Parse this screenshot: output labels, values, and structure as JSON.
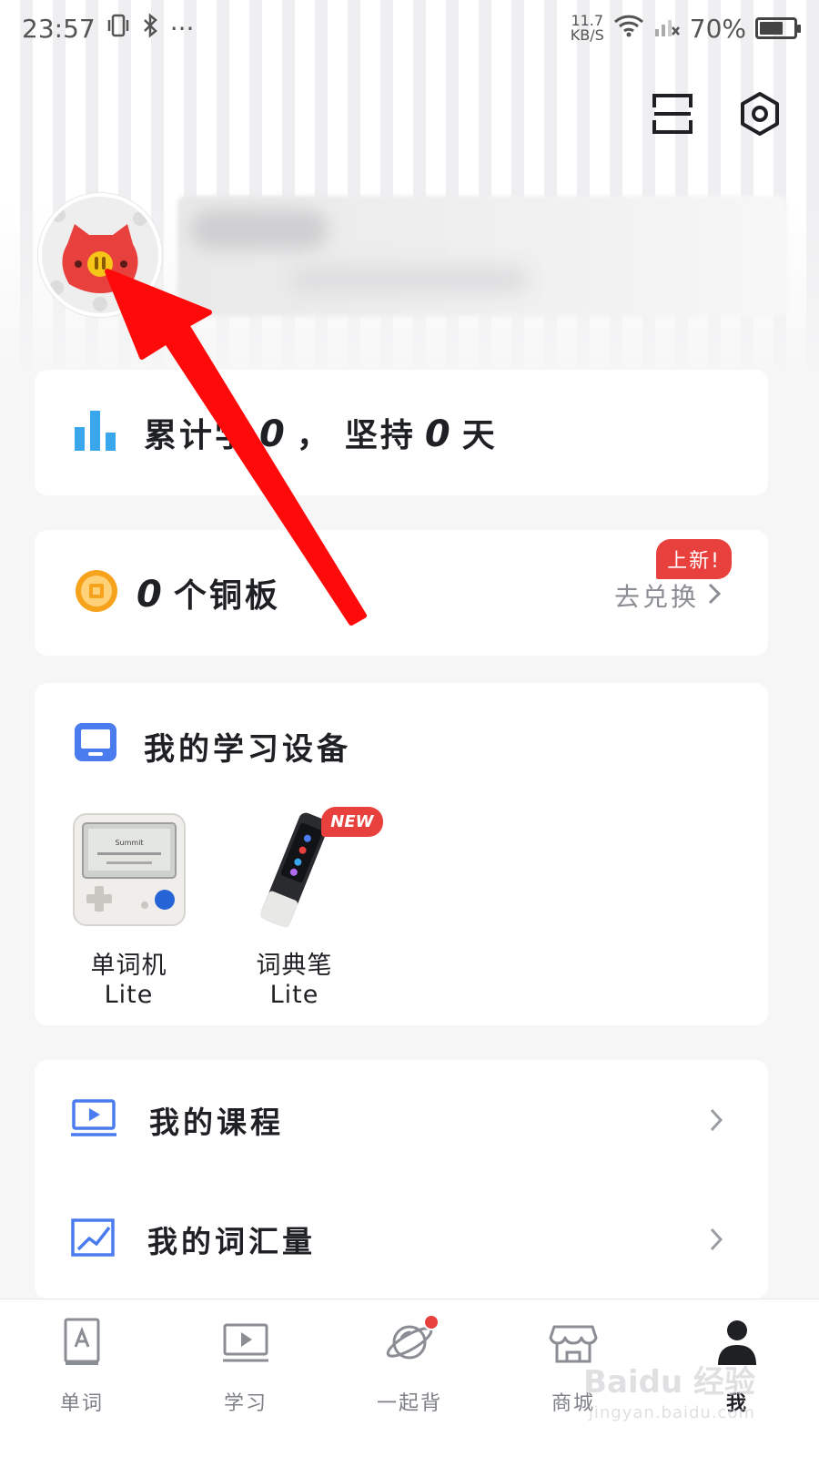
{
  "status_bar": {
    "time": "23:57",
    "more": "···",
    "speed_value": "11.7",
    "speed_unit": "KB/S",
    "battery": "70%",
    "battery_level": 0.7
  },
  "stats": {
    "prefix": "累计学",
    "days_learned": "0",
    "separator": "，",
    "middle": "坚持",
    "days_persisted": "0",
    "suffix": "天"
  },
  "coins": {
    "count": "0",
    "unit_label": "个铜板",
    "exchange_label": "去兑换",
    "badge": "上新!"
  },
  "devices": {
    "title": "我的学习设备",
    "items": [
      {
        "label": "单词机Lite",
        "tag": ""
      },
      {
        "label": "词典笔Lite",
        "tag": "NEW"
      }
    ],
    "screen_text": "Summit"
  },
  "menu": [
    {
      "label": "我的课程",
      "icon": "play-screen-icon"
    },
    {
      "label": "我的词汇量",
      "icon": "trend-chart-icon"
    }
  ],
  "bottom_nav": [
    {
      "label": "单词",
      "icon": "book-a-icon",
      "active": false
    },
    {
      "label": "学习",
      "icon": "video-play-icon",
      "active": false
    },
    {
      "label": "一起背",
      "icon": "planet-icon",
      "active": false,
      "dot": true
    },
    {
      "label": "商城",
      "icon": "store-icon",
      "active": false
    },
    {
      "label": "我",
      "icon": "person-icon",
      "active": true
    }
  ],
  "watermark": {
    "brand": "Baidu 经验",
    "url": "jingyan.baidu.com"
  },
  "colors": {
    "accent_blue": "#4a7cf0",
    "chart_blue": "#3aa6ec",
    "coin_orange": "#f7a21b",
    "badge_red": "#e8403d",
    "annotation_red": "#ff0a0a"
  }
}
